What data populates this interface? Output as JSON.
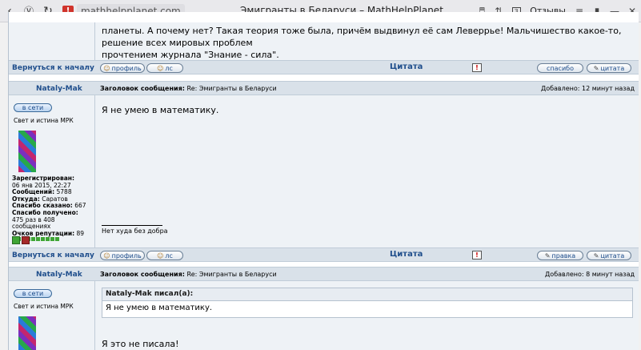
{
  "browser": {
    "url": "mathhelpplanet.com",
    "title": "Эмигранты в Беларуси – MathHelpPlanet",
    "reviews_label": "Отзывы",
    "tab_count": "3"
  },
  "top_post": {
    "text_line1": "планеты. А почему нет? Такая теория тоже была, причём выдвинул её сам Леверрье! Мальчишество какое-то, решение всех мировых проблем",
    "text_line2": "прочтением журнала \"Знание - сила\"."
  },
  "actions": {
    "back_to_top": "Вернуться к началу",
    "profile": "профиль",
    "pm": "лс",
    "quote_center": "Цитата",
    "warn": "!",
    "thanks": "спасибо",
    "quote": "цитата",
    "edit": "правка"
  },
  "post1": {
    "author": "Nataly-Mak",
    "subject_label": "Заголовок сообщения:",
    "subject": "Re: Эмигранты в Беларуси",
    "added": "Добавлено: 12 минут назад",
    "online": "в сети",
    "rank": "Свет и истина МРК",
    "body": "Я не умею в математику.",
    "signature": "Нет худа без добра",
    "stats": {
      "registered_label": "Зарегистрирован:",
      "registered": "06 янв 2015, 22:27",
      "messages_label": "Сообщений:",
      "messages": "5788",
      "from_label": "Откуда:",
      "from": "Саратов",
      "thanks_said_label": "Спасибо сказано:",
      "thanks_said": "667",
      "thanks_received_label": "Спасибо получено:",
      "thanks_received": "475 раз в 408 сообщениях",
      "reputation_label": "Очков репутации:",
      "reputation": "89"
    }
  },
  "post2": {
    "author": "Nataly-Mak",
    "subject_label": "Заголовок сообщения:",
    "subject": "Re: Эмигранты в Беларуси",
    "added": "Добавлено: 8 минут назад",
    "online": "в сети",
    "rank": "Свет и истина МРК",
    "quote_author": "Nataly-Mak писал(а):",
    "quote_text": "Я не умею в математику.",
    "body": "Я это не писала!"
  }
}
